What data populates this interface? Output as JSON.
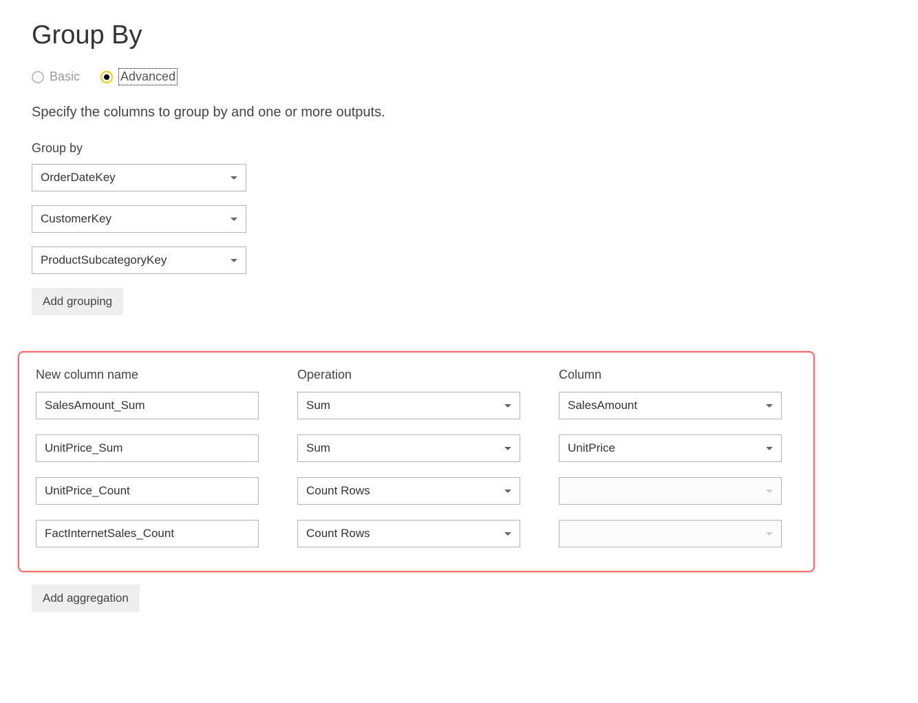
{
  "title": "Group By",
  "mode": {
    "basic_label": "Basic",
    "advanced_label": "Advanced"
  },
  "description": "Specify the columns to group by and one or more outputs.",
  "group_by_label": "Group by",
  "group_by_columns": [
    "OrderDateKey",
    "CustomerKey",
    "ProductSubcategoryKey"
  ],
  "add_grouping_label": "Add grouping",
  "agg_headers": {
    "new_column": "New column name",
    "operation": "Operation",
    "column": "Column"
  },
  "aggregations": [
    {
      "name": "SalesAmount_Sum",
      "operation": "Sum",
      "column": "SalesAmount",
      "column_enabled": true
    },
    {
      "name": "UnitPrice_Sum",
      "operation": "Sum",
      "column": "UnitPrice",
      "column_enabled": true
    },
    {
      "name": "UnitPrice_Count",
      "operation": "Count Rows",
      "column": "",
      "column_enabled": false
    },
    {
      "name": "FactInternetSales_Count",
      "operation": "Count Rows",
      "column": "",
      "column_enabled": false
    }
  ],
  "add_aggregation_label": "Add aggregation"
}
